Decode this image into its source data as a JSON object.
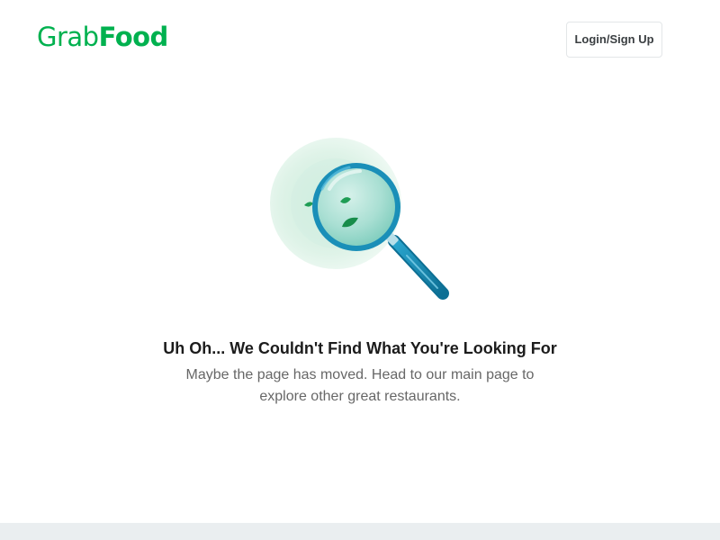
{
  "header": {
    "logo_part1": "Grab",
    "logo_part2": "Food",
    "login_label": "Login/Sign Up"
  },
  "main": {
    "title": "Uh Oh... We Couldn't Find What You're Looking For",
    "message": "Maybe the page has moved. Head to our main page to explore other great restaurants.",
    "illustration_icon": "magnifying-glass-icon"
  },
  "colors": {
    "brand_green": "#00b14f",
    "magnifier_blue": "#1a8fb8",
    "footer_bg": "#eaeef0"
  }
}
